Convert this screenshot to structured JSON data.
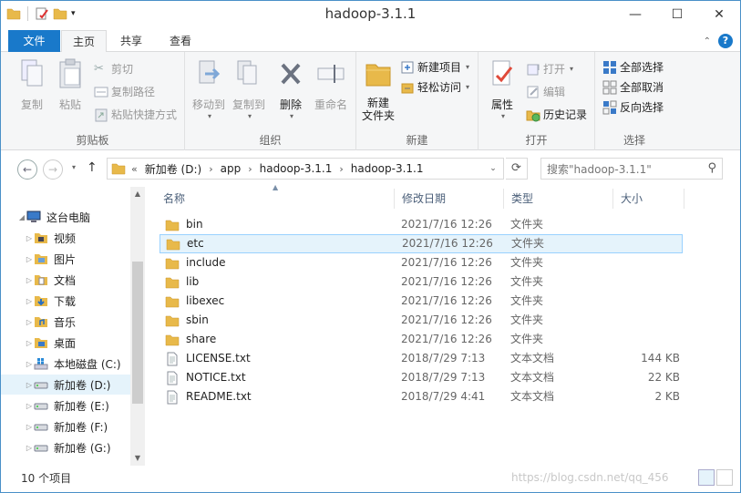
{
  "window": {
    "title": "hadoop-3.1.1"
  },
  "window_buttons": {
    "minimize": "—",
    "maximize": "☐",
    "close": "✕"
  },
  "ribbon_tabs": {
    "file": "文件",
    "home": "主页",
    "share": "共享",
    "view": "查看"
  },
  "ribbon": {
    "clipboard": {
      "label": "剪贴板",
      "copy": "复制",
      "paste": "粘贴",
      "cut": "剪切",
      "copy_path": "复制路径",
      "paste_shortcut": "粘贴快捷方式"
    },
    "organize": {
      "label": "组织",
      "move_to": "移动到",
      "copy_to": "复制到",
      "delete": "删除",
      "rename": "重命名"
    },
    "new": {
      "label": "新建",
      "new_folder": "新建\n文件夹",
      "new_item": "新建项目",
      "easy_access": "轻松访问"
    },
    "open": {
      "label": "打开",
      "properties": "属性",
      "open": "打开",
      "edit": "编辑",
      "history": "历史记录"
    },
    "select": {
      "label": "选择",
      "select_all": "全部选择",
      "select_none": "全部取消",
      "invert": "反向选择"
    }
  },
  "address": {
    "overflow": "«",
    "crumbs": [
      "新加卷 (D:)",
      "app",
      "hadoop-3.1.1",
      "hadoop-3.1.1"
    ],
    "search_placeholder": "搜索\"hadoop-3.1.1\""
  },
  "nav_pane": {
    "items": [
      {
        "label": "这台电脑",
        "icon": "computer-icon",
        "level": 0
      },
      {
        "label": "视频",
        "icon": "videos-folder-icon",
        "level": 1
      },
      {
        "label": "图片",
        "icon": "pictures-folder-icon",
        "level": 1
      },
      {
        "label": "文档",
        "icon": "documents-folder-icon",
        "level": 1
      },
      {
        "label": "下载",
        "icon": "downloads-folder-icon",
        "level": 1
      },
      {
        "label": "音乐",
        "icon": "music-folder-icon",
        "level": 1
      },
      {
        "label": "桌面",
        "icon": "desktop-folder-icon",
        "level": 1
      },
      {
        "label": "本地磁盘 (C:)",
        "icon": "windows-drive-icon",
        "level": 1
      },
      {
        "label": "新加卷 (D:)",
        "icon": "drive-icon",
        "level": 1
      },
      {
        "label": "新加卷 (E:)",
        "icon": "drive-icon",
        "level": 1
      },
      {
        "label": "新加卷 (F:)",
        "icon": "drive-icon",
        "level": 1
      },
      {
        "label": "新加卷 (G:)",
        "icon": "drive-icon",
        "level": 1
      }
    ]
  },
  "columns": {
    "name": "名称",
    "date": "修改日期",
    "type": "类型",
    "size": "大小"
  },
  "files": [
    {
      "name": "bin",
      "date": "2021/7/16 12:26",
      "type": "文件夹",
      "size": "",
      "kind": "folder"
    },
    {
      "name": "etc",
      "date": "2021/7/16 12:26",
      "type": "文件夹",
      "size": "",
      "kind": "folder"
    },
    {
      "name": "include",
      "date": "2021/7/16 12:26",
      "type": "文件夹",
      "size": "",
      "kind": "folder"
    },
    {
      "name": "lib",
      "date": "2021/7/16 12:26",
      "type": "文件夹",
      "size": "",
      "kind": "folder"
    },
    {
      "name": "libexec",
      "date": "2021/7/16 12:26",
      "type": "文件夹",
      "size": "",
      "kind": "folder"
    },
    {
      "name": "sbin",
      "date": "2021/7/16 12:26",
      "type": "文件夹",
      "size": "",
      "kind": "folder"
    },
    {
      "name": "share",
      "date": "2021/7/16 12:26",
      "type": "文件夹",
      "size": "",
      "kind": "folder"
    },
    {
      "name": "LICENSE.txt",
      "date": "2018/7/29 7:13",
      "type": "文本文档",
      "size": "144 KB",
      "kind": "text"
    },
    {
      "name": "NOTICE.txt",
      "date": "2018/7/29 7:13",
      "type": "文本文档",
      "size": "22 KB",
      "kind": "text"
    },
    {
      "name": "README.txt",
      "date": "2018/7/29 4:41",
      "type": "文本文档",
      "size": "2 KB",
      "kind": "text"
    }
  ],
  "status": {
    "count": "10 个项目",
    "watermark": "https://blog.csdn.net/qq_456"
  },
  "colors": {
    "accent": "#1979ca",
    "folder": "#e8b94a",
    "selection": "#e5f3fb",
    "selection_border": "#99d1ff"
  }
}
